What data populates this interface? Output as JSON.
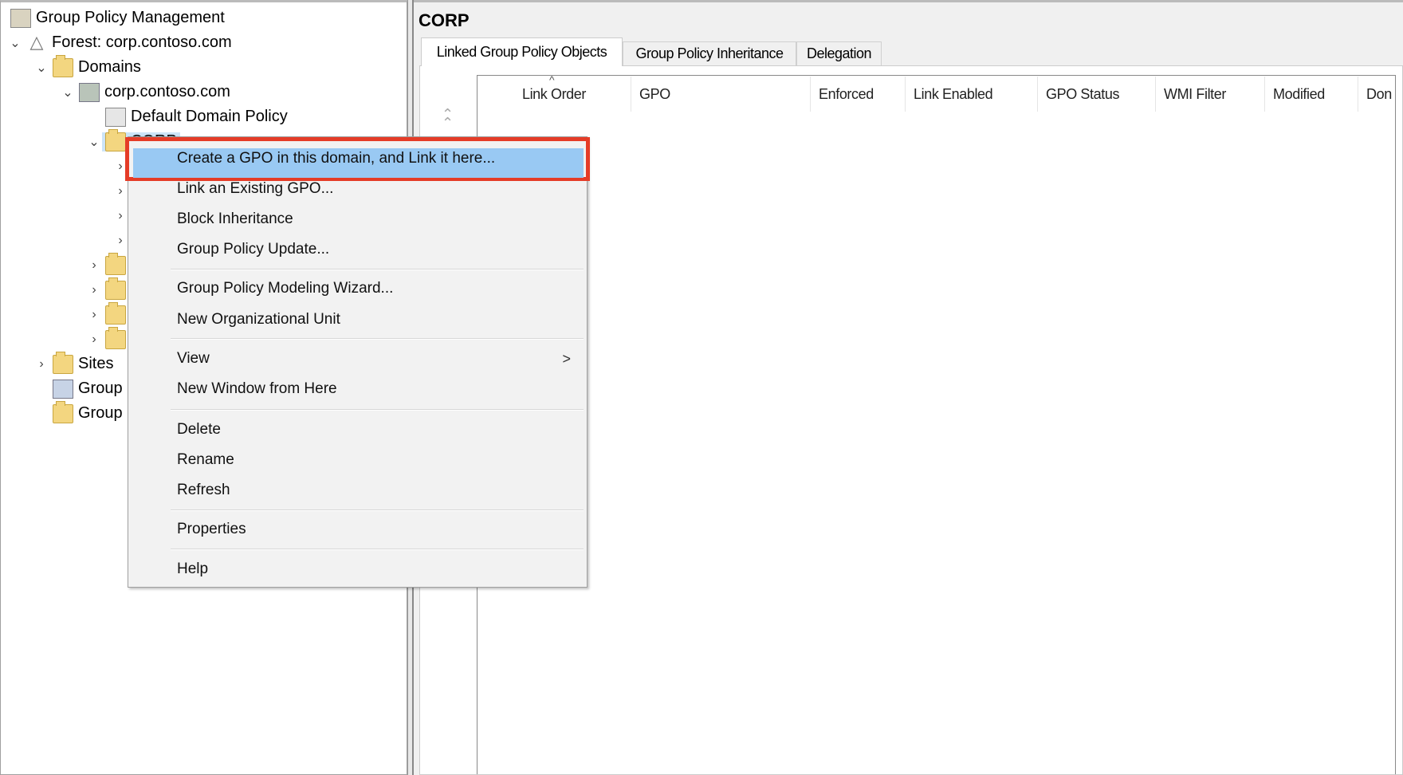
{
  "tree": {
    "root": "Group Policy Management",
    "forest": "Forest: corp.contoso.com",
    "domains": "Domains",
    "domain": "corp.contoso.com",
    "default_policy": "Default Domain Policy",
    "corp": "CORP",
    "sites": "Sites",
    "group1": "Group",
    "group2": "Group"
  },
  "right": {
    "title": "CORP",
    "tabs": [
      {
        "label": "Linked Group Policy Objects",
        "active": true
      },
      {
        "label": "Group Policy Inheritance"
      },
      {
        "label": "Delegation"
      }
    ],
    "columns": [
      "Link Order",
      "GPO",
      "Enforced",
      "Link Enabled",
      "GPO Status",
      "WMI Filter",
      "Modified",
      "Don"
    ],
    "sort_indicator": "^"
  },
  "menu": {
    "items": [
      "Create a GPO in this domain, and Link it here...",
      "Link an Existing GPO...",
      "Block Inheritance",
      "Group Policy Update...",
      "Group Policy Modeling Wizard...",
      "New Organizational Unit",
      "View",
      "New Window from Here",
      "Delete",
      "Rename",
      "Refresh",
      "Properties",
      "Help"
    ],
    "submenu_arrow": ">",
    "highlight_color": "#e53c27"
  }
}
